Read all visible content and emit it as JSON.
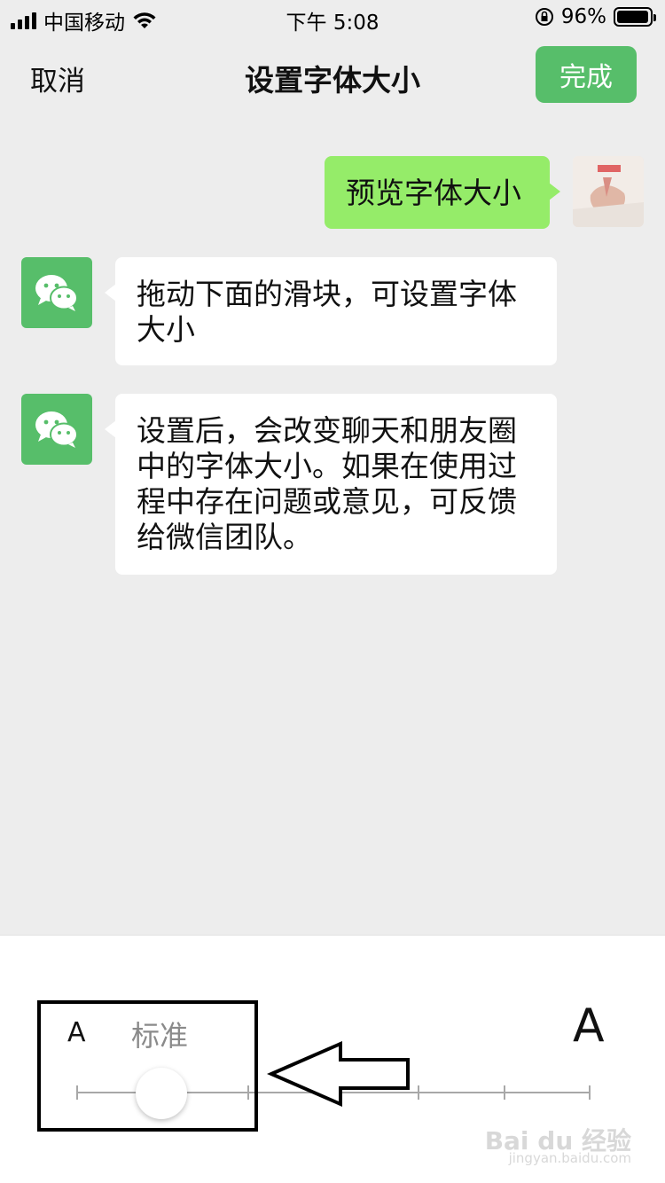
{
  "status_bar": {
    "carrier": "中国移动",
    "time": "下午 5:08",
    "battery_percent": "96%",
    "battery_level": 0.96
  },
  "nav": {
    "cancel_label": "取消",
    "title": "设置字体大小",
    "done_label": "完成",
    "done_color": "#57be6a"
  },
  "chat": {
    "messages": [
      {
        "direction": "out",
        "text": "预览字体大小",
        "avatar": "user-photo"
      },
      {
        "direction": "in",
        "text": "拖动下面的滑块，可设置字体大小",
        "avatar": "wechat-logo-icon"
      },
      {
        "direction": "in",
        "text": "设置后，会改变聊天和朋友圈中的字体大小。如果在使用过程中存在问题或意见，可反馈给微信团队。",
        "avatar": "wechat-logo-icon"
      }
    ],
    "outgoing_bubble_color": "#95ec69",
    "incoming_bubble_color": "#ffffff"
  },
  "font_size_panel": {
    "small_label": "A",
    "current_label": "标准",
    "large_label": "A",
    "steps": 7,
    "selected_step": 1
  },
  "watermark": {
    "brand": "Bai du 经验",
    "url": "jingyan.baidu.com"
  }
}
